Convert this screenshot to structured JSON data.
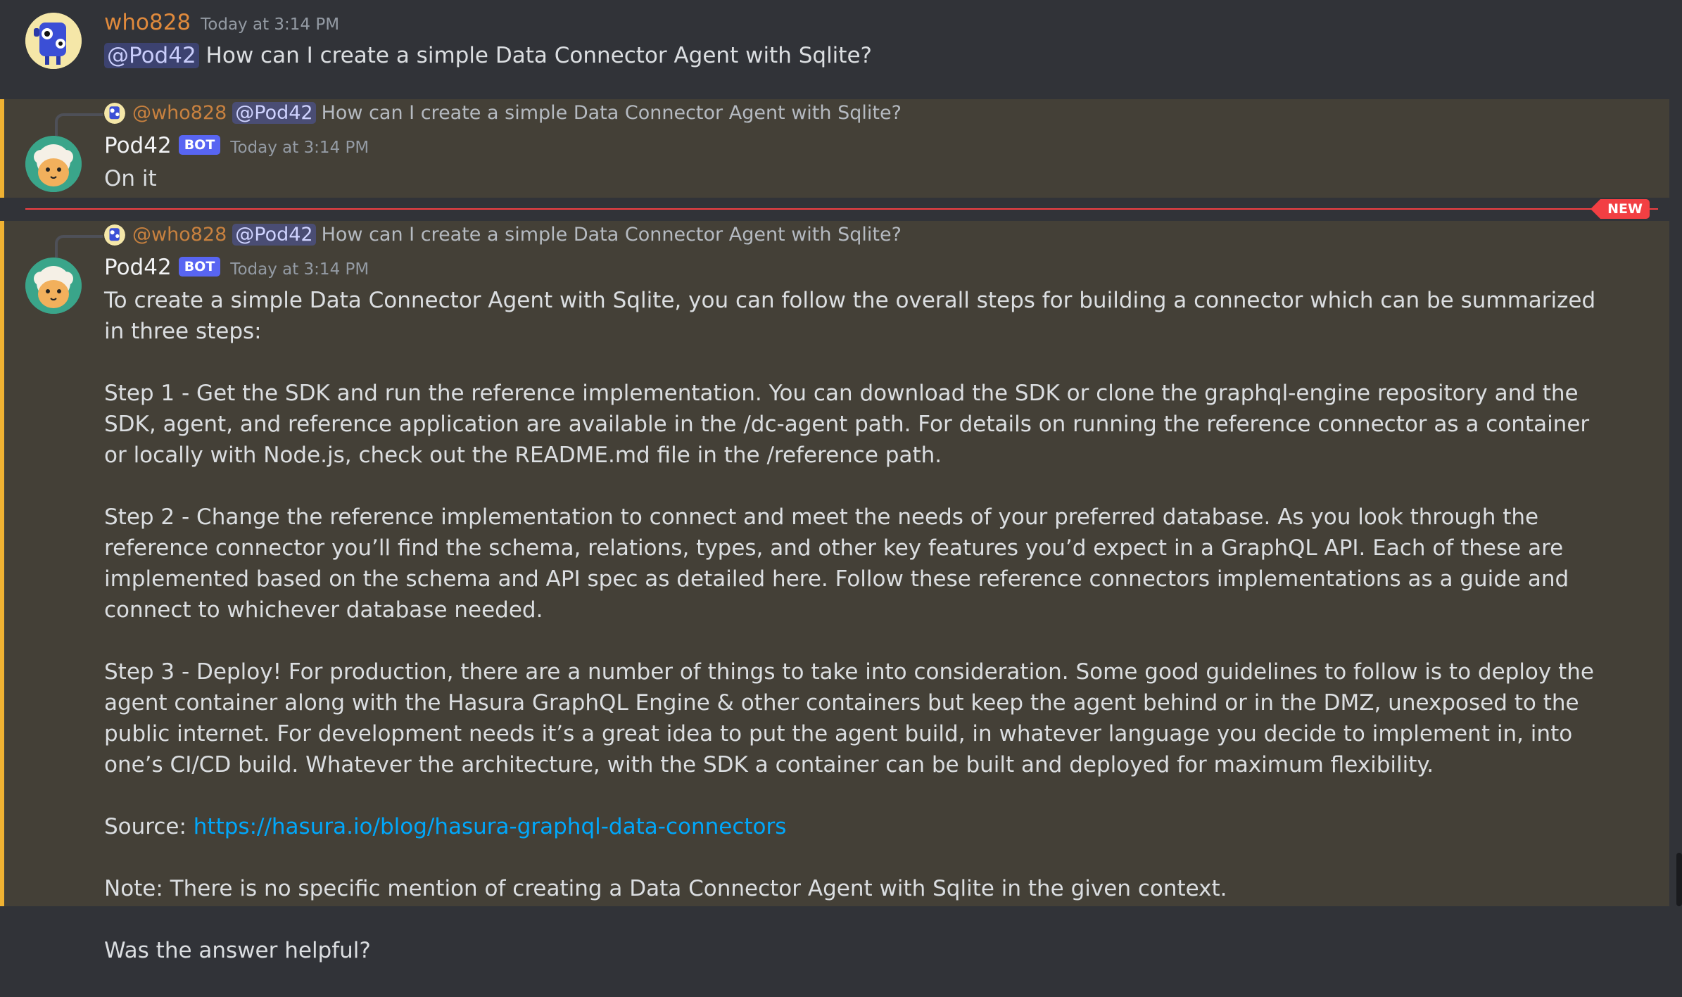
{
  "messages": [
    {
      "author": "who828",
      "author_color": "#e08a3c",
      "timestamp": "Today at 3:14 PM",
      "mention": "@Pod42",
      "text": "How can I create a simple Data Connector Agent with Sqlite?"
    },
    {
      "author": "Pod42",
      "bot_tag": "BOT",
      "timestamp": "Today at 3:14 PM",
      "reply": {
        "author": "@who828",
        "mention": "@Pod42",
        "text": "How can I create a simple Data Connector Agent with Sqlite?"
      },
      "text": "On it"
    },
    {
      "author": "Pod42",
      "bot_tag": "BOT",
      "timestamp": "Today at 3:14 PM",
      "reply": {
        "author": "@who828",
        "mention": "@Pod42",
        "text": "How can I create a simple Data Connector Agent with Sqlite?"
      },
      "paragraphs": [
        "To create a simple Data Connector Agent with Sqlite, you can follow the overall steps for building a connector which can be summarized in three steps:",
        "Step 1 - Get the SDK and run the reference implementation. You can download the SDK or clone the graphql-engine repository and the SDK, agent, and reference application are available in the /dc-agent path. For details on running the reference connector as a container or locally with Node.js, check out the README.md file in the /reference path.",
        "Step 2 - Change the reference implementation to connect and meet the needs of your preferred database. As you look through the reference connector you’ll find the schema, relations, types, and other key features you’d expect in a GraphQL API. Each of these are implemented based on the schema and API spec as detailed here. Follow these reference connectors implementations as a guide and connect to whichever database needed.",
        "Step 3 - Deploy! For production, there are a number of things to take into consideration. Some good guidelines to follow is to deploy the agent container along with the Hasura GraphQL Engine & other containers but keep the agent behind or in the DMZ, unexposed to the public internet. For development needs it’s a great idea to put the agent build, in whatever language you decide to implement in, into one’s CI/CD build. Whatever the architecture, with the SDK a container can be built and deployed for maximum flexibility."
      ],
      "source_label": "Source:",
      "source_url": "https://hasura.io/blog/hasura-graphql-data-connectors",
      "note": "Note: There is no specific mention of creating a Data Connector Agent with Sqlite in the given context.",
      "question": "Was the answer helpful?"
    }
  ],
  "divider_label": "NEW",
  "colors": {
    "background": "#313338",
    "mentioned_background": "#444037",
    "mentioned_border": "#f0b232",
    "accent": "#5865f2",
    "link": "#00a8fc",
    "new_divider": "#f23f43"
  }
}
